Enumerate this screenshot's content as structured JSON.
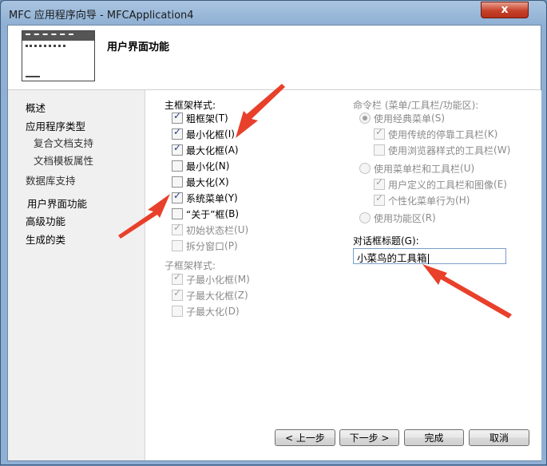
{
  "window": {
    "title": "MFC 应用程序向导 - MFCApplication4",
    "close_glyph": "x"
  },
  "header": {
    "title": "用户界面功能"
  },
  "nav": {
    "items": [
      {
        "label": "概述"
      },
      {
        "label": "应用程序类型"
      },
      {
        "label": "复合文档支持"
      },
      {
        "label": "文档模板属性"
      },
      {
        "label": "数据库支持"
      },
      {
        "label": "用户界面功能"
      },
      {
        "label": "高级功能"
      },
      {
        "label": "生成的类"
      }
    ]
  },
  "main_frame": {
    "label": "主框架样式:",
    "options": [
      {
        "label": "粗框架",
        "key": "T",
        "checked": true
      },
      {
        "label": "最小化框",
        "key": "I",
        "checked": true
      },
      {
        "label": "最大化框",
        "key": "A",
        "checked": true
      },
      {
        "label": "最小化",
        "key": "N",
        "checked": false
      },
      {
        "label": "最大化",
        "key": "X",
        "checked": false
      },
      {
        "label": "系统菜单",
        "key": "Y",
        "checked": true
      },
      {
        "label": "“关于”框",
        "key": "B",
        "checked": false
      },
      {
        "label": "初始状态栏",
        "key": "U",
        "checked": true
      },
      {
        "label": "拆分窗口",
        "key": "P",
        "checked": false
      }
    ]
  },
  "child_frame": {
    "label": "子框架样式:",
    "options": [
      {
        "label": "子最小化框",
        "key": "M",
        "checked": true
      },
      {
        "label": "子最大化框",
        "key": "Z",
        "checked": true
      },
      {
        "label": "子最大化",
        "key": "D",
        "checked": false
      }
    ]
  },
  "command_bar": {
    "label": "命令栏 (菜单/工具栏/功能区):",
    "classic_menu": {
      "label": "使用经典菜单",
      "key": "S",
      "checked": true
    },
    "classic_sub": [
      {
        "label": "使用传统的停靠工具栏",
        "key": "K",
        "checked": true
      },
      {
        "label": "使用浏览器样式的工具栏",
        "key": "W",
        "checked": false
      }
    ],
    "menubar": {
      "label": "使用菜单栏和工具栏",
      "key": "U",
      "checked": false
    },
    "menubar_sub": [
      {
        "label": "用户定义的工具栏和图像",
        "key": "E",
        "checked": true
      },
      {
        "label": "个性化菜单行为",
        "key": "H",
        "checked": true
      }
    ],
    "ribbon": {
      "label": "使用功能区",
      "key": "R",
      "checked": false
    }
  },
  "dialog_title": {
    "label": "对话框标题(G):",
    "value": "小菜鸟的工具箱"
  },
  "buttons": {
    "prev": "< 上一步",
    "next": "下一步 >",
    "finish": "完成",
    "cancel": "取消"
  },
  "annotation_color": "#e8402a"
}
